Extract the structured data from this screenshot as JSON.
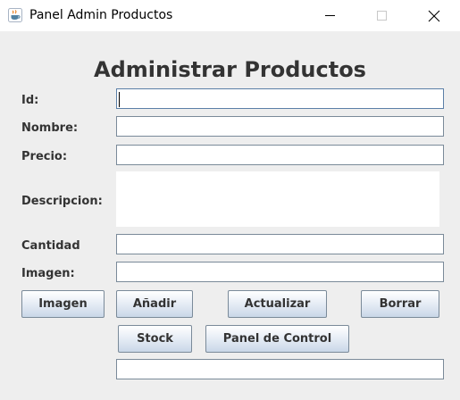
{
  "window": {
    "title": "Panel Admin Productos"
  },
  "icons": {
    "app": "java-cup-icon",
    "minimize": "minimize-icon",
    "maximize": "maximize-icon",
    "close": "close-icon"
  },
  "form": {
    "heading": "Administrar Productos",
    "labels": {
      "id": "Id:",
      "nombre": "Nombre:",
      "precio": "Precio:",
      "descripcion": "Descripcion:",
      "cantidad": "Cantidad",
      "imagen": "Imagen:"
    },
    "values": {
      "id": "",
      "nombre": "",
      "precio": "",
      "descripcion": "",
      "cantidad": "",
      "imagen": "",
      "extra": ""
    }
  },
  "buttons": {
    "imagen": "Imagen",
    "anadir": "Añadir",
    "actualizar": "Actualizar",
    "borrar": "Borrar",
    "stock": "Stock",
    "panel_control": "Panel de Control"
  },
  "colors": {
    "background": "#eeeeee",
    "titlebar": "#ffffff",
    "text": "#333333",
    "field_border": "#7a8a99",
    "button_gradient_bottom": "#c9d7e8"
  }
}
